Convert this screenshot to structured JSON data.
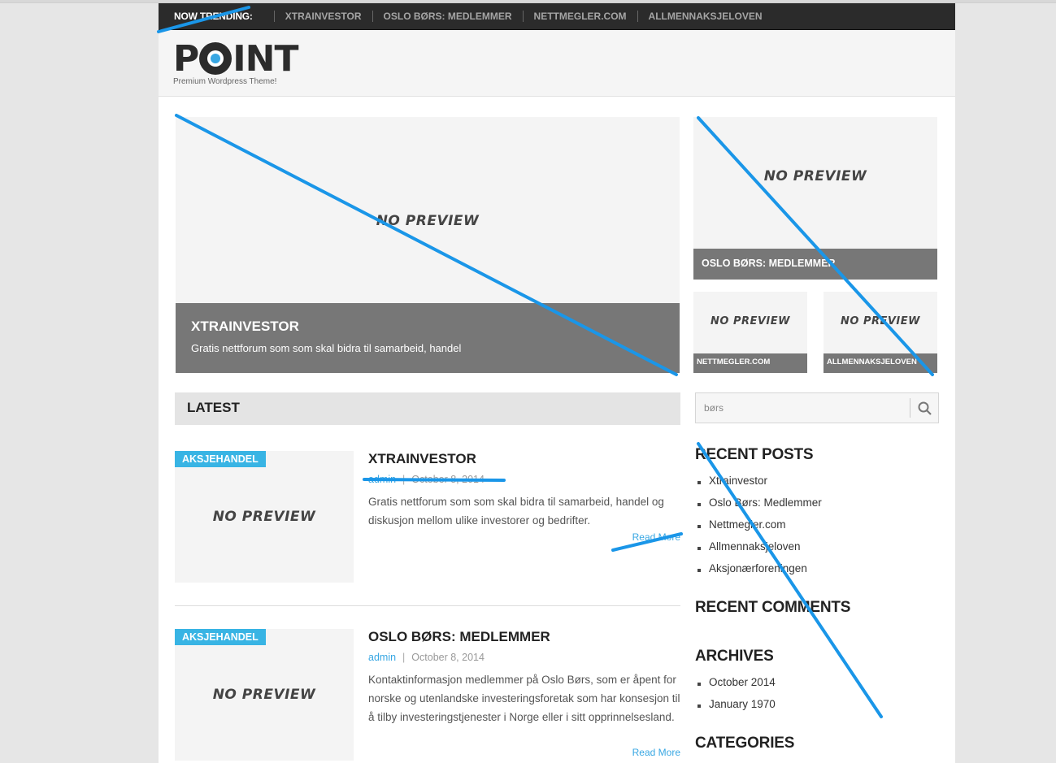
{
  "trending": {
    "label": "NOW TRENDING:",
    "links": [
      "XTRAINVESTOR",
      "OSLO BØRS: MEDLEMMER",
      "NETTMEGLER.COM",
      "ALLMENNAKSJELOVEN"
    ]
  },
  "header": {
    "logo_p": "P",
    "logo_int": "INT",
    "tagline": "Premium Wordpress Theme!"
  },
  "featured": {
    "no_preview": "NO PREVIEW",
    "big": {
      "title": "XTRAINVESTOR",
      "desc": "Gratis nettforum som som skal bidra til samarbeid, handel"
    },
    "right": {
      "title": "OSLO BØRS: MEDLEMMER"
    },
    "small1": {
      "title": "NETTMEGLER.COM"
    },
    "small2": {
      "title": "ALLMENNAKSJELOVEN"
    }
  },
  "latest": {
    "heading": "LATEST",
    "posts": [
      {
        "category": "AKSJEHANDEL",
        "title": "XTRAINVESTOR",
        "author": "admin",
        "date": "October 8, 2014",
        "excerpt": "Gratis nettforum som som skal bidra til samarbeid, handel og diskusjon mellom ulike investorer og bedrifter.",
        "read_more": "Read More"
      },
      {
        "category": "AKSJEHANDEL",
        "title": "OSLO BØRS: MEDLEMMER",
        "author": "admin",
        "date": "October 8, 2014",
        "excerpt": "Kontaktinformasjon medlemmer på Oslo Børs, som er åpent for norske og utenlandske investeringsforetak som har konsesjon til å tilby investeringstjenester i Norge eller i sitt opprinnelsesland.",
        "read_more": "Read More"
      }
    ],
    "meta_sep": "|"
  },
  "sidebar": {
    "search_value": "børs",
    "recent_posts_title": "RECENT POSTS",
    "recent_posts": [
      "Xtrainvestor",
      "Oslo Børs: Medlemmer",
      "Nettmegler.com",
      "Allmennaksjeloven",
      "Aksjonærforeningen"
    ],
    "recent_comments_title": "RECENT COMMENTS",
    "archives_title": "ARCHIVES",
    "archives": [
      "October 2014",
      "January 1970"
    ],
    "categories_title": "CATEGORIES"
  },
  "colors": {
    "accent": "#38a7e3",
    "badge": "#38b4e4",
    "topbar": "#2b2b2b",
    "caption_bg": "#777777",
    "annotation_strike": "#1a96e8"
  },
  "icons": [
    "search-icon"
  ]
}
